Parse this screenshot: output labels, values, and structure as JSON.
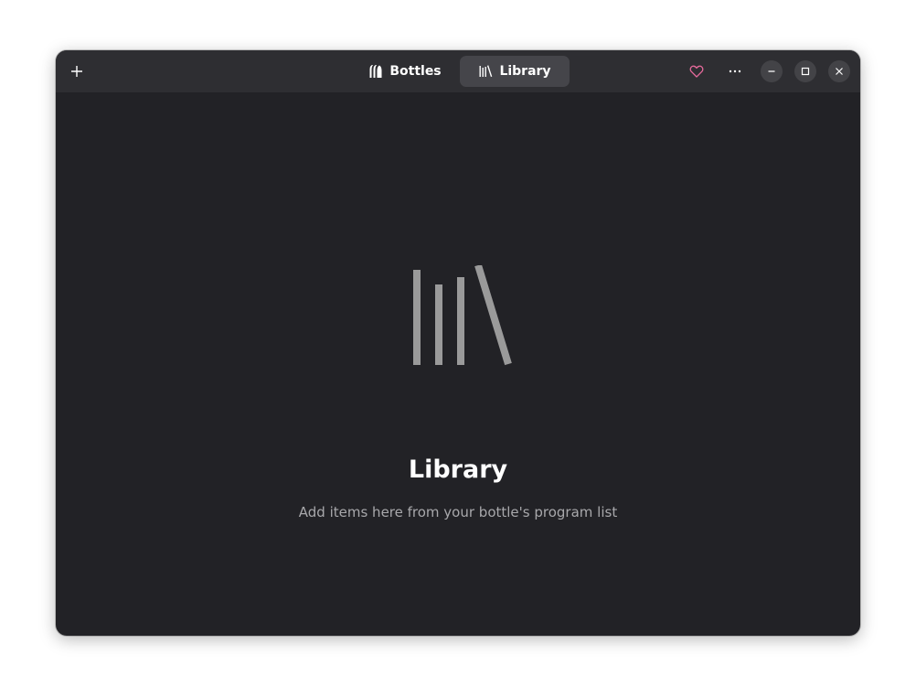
{
  "headerbar": {
    "add_icon": "plus-icon",
    "view_switcher": [
      {
        "label": "Bottles",
        "icon": "bottles-icon",
        "active": false
      },
      {
        "label": "Library",
        "icon": "library-icon",
        "active": true
      }
    ],
    "heart_icon": "heart-icon",
    "menu_icon": "more-horizontal-icon",
    "window_controls": [
      "minimize-icon",
      "maximize-icon",
      "close-icon"
    ]
  },
  "status_page": {
    "icon": "library-icon",
    "title": "Library",
    "description": "Add items here from your bottle's program list"
  },
  "colors": {
    "window_bg": "#222226",
    "headerbar_bg": "#2e2e32",
    "active_tab_bg": "#45454a",
    "heart_accent": "#e66a9c",
    "icon_gray": "#9a9a9a"
  }
}
